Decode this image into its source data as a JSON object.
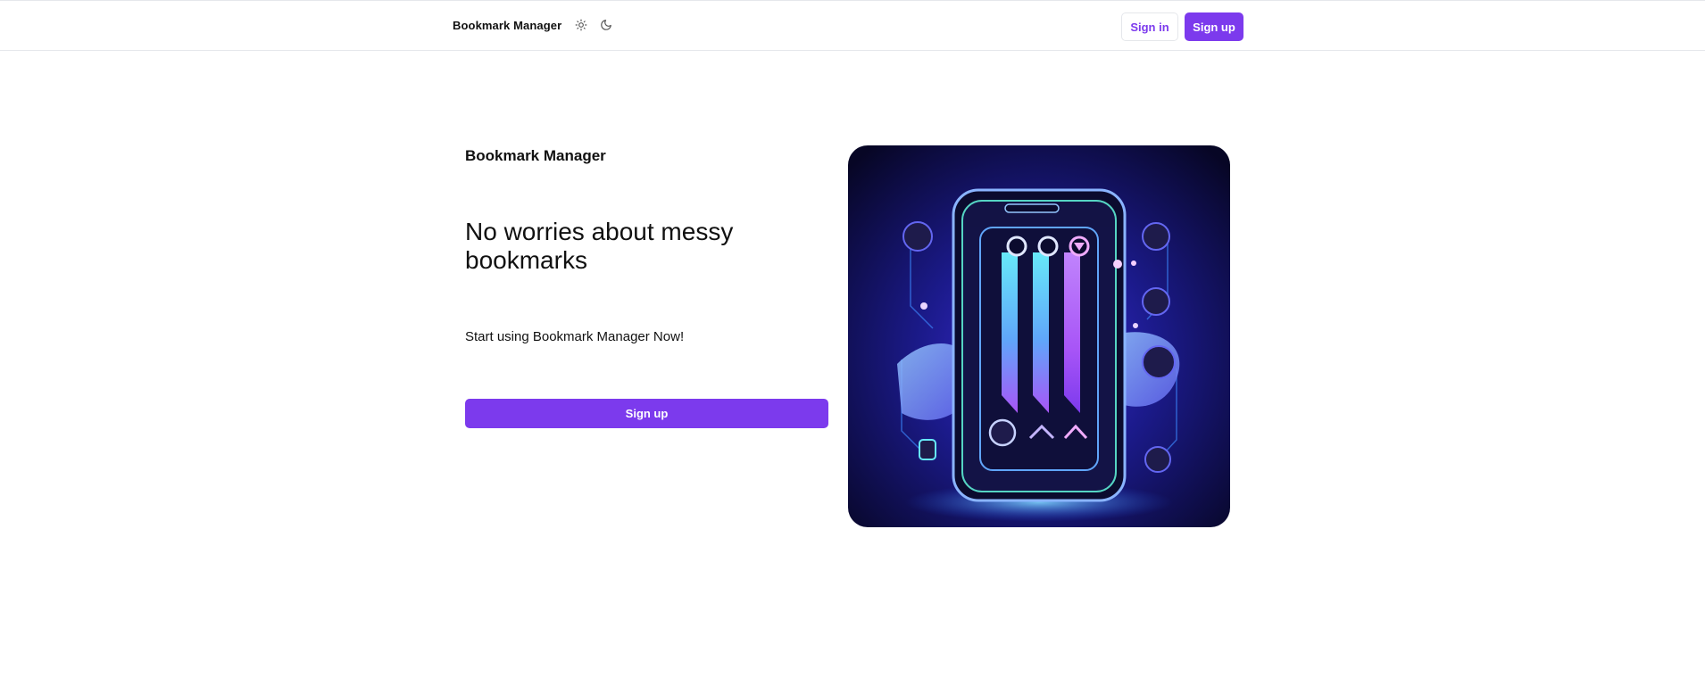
{
  "header": {
    "brand": "Bookmark Manager",
    "sign_in_label": "Sign in",
    "sign_up_label": "Sign up",
    "light_theme_icon": "sun-icon",
    "dark_theme_icon": "moon-icon"
  },
  "hero": {
    "brand": "Bookmark Manager",
    "headline": "No worries about messy bookmarks",
    "subtext": "Start using Bookmark Manager Now!",
    "cta_label": "Sign up",
    "image_subject": "neon phone illustration with bookmark ribbons"
  },
  "colors": {
    "accent": "#7c3aed",
    "border": "#e5e7eb",
    "text": "#111111"
  }
}
